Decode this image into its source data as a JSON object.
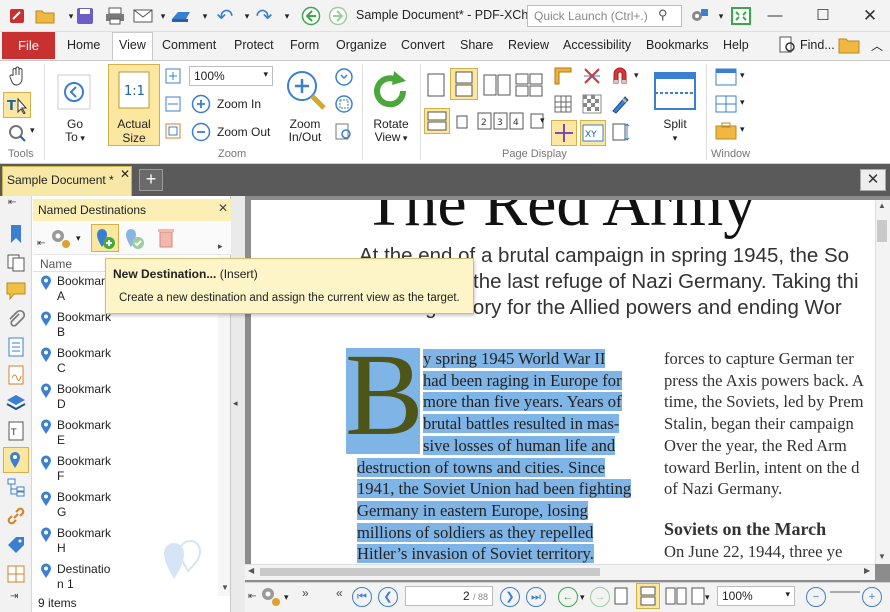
{
  "window": {
    "title": "Sample Document* - PDF-XCh...",
    "quick_launch_placeholder": "Quick Launch (Ctrl+.)"
  },
  "menu": {
    "file": "File",
    "tabs": [
      "Home",
      "View",
      "Comment",
      "Protect",
      "Form",
      "Organize",
      "Convert",
      "Share",
      "Review",
      "Accessibility",
      "Bookmarks",
      "Help"
    ],
    "find": "Find..."
  },
  "ribbon": {
    "go_to_line1": "Go",
    "go_to_line2": "To",
    "actual_size_line1": "Actual",
    "actual_size_line2": "Size",
    "zoom_value": "100%",
    "zoom_in": "Zoom In",
    "zoom_out": "Zoom Out",
    "zoom_inout_line1": "Zoom",
    "zoom_inout_line2": "In/Out",
    "rotate_line1": "Rotate",
    "rotate_line2": "View",
    "split": "Split",
    "groups": {
      "tools": "Tools",
      "zoom": "Zoom",
      "page_display": "Page Display",
      "window": "Window"
    }
  },
  "doc_tab": {
    "label": "Sample Document *"
  },
  "panel": {
    "title": "Named Destinations",
    "column_name": "Name",
    "items": [
      {
        "line1": "Bookmark",
        "line2": "A"
      },
      {
        "line1": "Bookmark",
        "line2": "B"
      },
      {
        "line1": "Bookmark",
        "line2": "C"
      },
      {
        "line1": "Bookmark",
        "line2": "D"
      },
      {
        "line1": "Bookmark",
        "line2": "E"
      },
      {
        "line1": "Bookmark",
        "line2": "F"
      },
      {
        "line1": "Bookmark",
        "line2": "G"
      },
      {
        "line1": "Bookmark",
        "line2": "H"
      },
      {
        "line1": "Destinatio",
        "line2": "n 1"
      }
    ],
    "items_count": "9 items"
  },
  "tooltip": {
    "title": "New Destination...",
    "shortcut": "(Insert)",
    "body": "Create a new destination and assign the current view as the target."
  },
  "document": {
    "heading": "The Red Army",
    "intro": [
      "At the end of a brutal campaign in spring 1945, the So",
      "the last refuge of Nazi Germany. Taking thi",
      "securing victory for the Allied powers and ending Wor"
    ],
    "drop_cap": "B",
    "col1": [
      "y spring 1945 World War II",
      "had been raging in Europe for",
      "more than five years. Years of",
      "brutal battles resulted in mas-",
      "sive losses of human life and",
      "destruction of towns and cities. Since",
      "1941, the Soviet Union had been fighting",
      "Germany in eastern Europe, losing",
      "millions of soldiers as they repelled",
      "Hitler’s invasion of Soviet territory."
    ],
    "col2": [
      "forces to capture German ter",
      "press the Axis powers back. A",
      "time, the Soviets, led by Prem",
      "Stalin, began their campaign",
      "Over the year, the Red Arm",
      "toward Berlin, intent on the d",
      "of Nazi Germany."
    ],
    "subheading": "Soviets on the March",
    "col2_after": "On June 22, 1944, three ye"
  },
  "status": {
    "page_current": "2",
    "page_total": "/ 88",
    "zoom": "100%"
  }
}
